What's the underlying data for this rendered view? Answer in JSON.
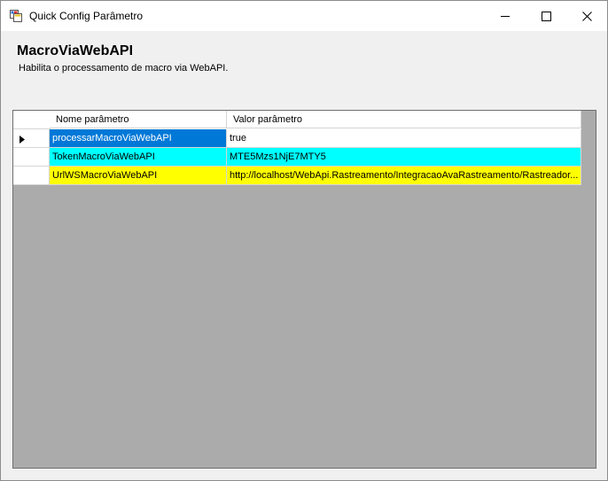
{
  "window": {
    "title": "Quick Config Parâmetro",
    "controls": {
      "minimize": "minimize",
      "maximize": "maximize",
      "close": "close"
    }
  },
  "header": {
    "title": "MacroViaWebAPI",
    "description": "Habilita o processamento de macro via WebAPI."
  },
  "grid": {
    "columns": [
      "Nome parâmetro",
      "Valor parâmetro"
    ],
    "rows": [
      {
        "name": "processarMacroViaWebAPI",
        "value": "true",
        "name_bg": "#0078d7",
        "name_color": "#ffffff",
        "value_bg": "#ffffff",
        "value_color": "#000000",
        "current": true
      },
      {
        "name": "TokenMacroViaWebAPI",
        "value": "MTE5Mzs1NjE7MTY5",
        "name_bg": "#00ffff",
        "name_color": "#000000",
        "value_bg": "#00ffff",
        "value_color": "#000000",
        "current": false
      },
      {
        "name": "UrlWSMacroViaWebAPI",
        "value": "http://localhost/WebApi.Rastreamento/IntegracaoAvaRastreamento/Rastreador...",
        "name_bg": "#ffff00",
        "name_color": "#000000",
        "value_bg": "#ffff00",
        "value_color": "#000000",
        "current": false
      }
    ],
    "empty_bg": "#ababab"
  }
}
